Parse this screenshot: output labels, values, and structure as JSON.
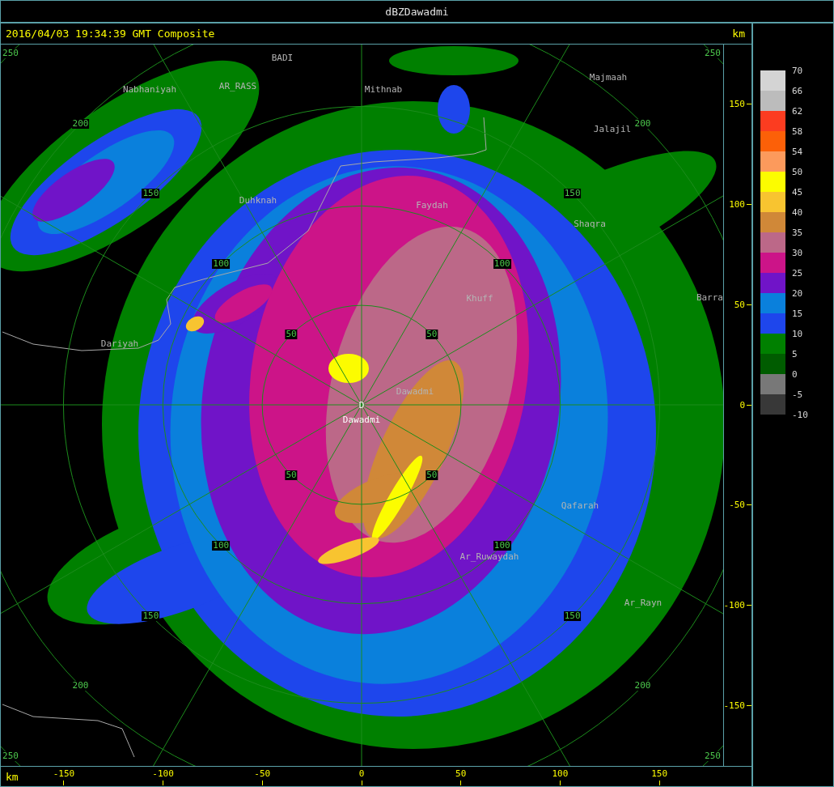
{
  "window": {
    "title": "dBZDawadmi"
  },
  "header": {
    "timestamp": "2016/04/03 19:34:39 GMT Composite",
    "unit": "km"
  },
  "map": {
    "site_marker": "D",
    "cities": [
      {
        "name": "BADI",
        "kind": "town"
      },
      {
        "name": "AR_RASS",
        "kind": "town"
      },
      {
        "name": "Mithnab",
        "kind": "town"
      },
      {
        "name": "Majmaah",
        "kind": "town"
      },
      {
        "name": "Nabhaniyah",
        "kind": "town"
      },
      {
        "name": "Jalajil",
        "kind": "town"
      },
      {
        "name": "Duhknah",
        "kind": "town"
      },
      {
        "name": "Faydah",
        "kind": "town"
      },
      {
        "name": "Shaqra",
        "kind": "town"
      },
      {
        "name": "Khuff",
        "kind": "town"
      },
      {
        "name": "Barra",
        "kind": "town"
      },
      {
        "name": "Dariyah",
        "kind": "town"
      },
      {
        "name": "Dawadmi",
        "kind": "town"
      },
      {
        "name": "Dawadmi",
        "kind": "site"
      },
      {
        "name": "Qafarah",
        "kind": "town"
      },
      {
        "name": "Ar_Ruwaydah",
        "kind": "town"
      },
      {
        "name": "Ar_Rayn",
        "kind": "town"
      }
    ],
    "range_rings": [
      {
        "labels": [
          "50",
          "50",
          "50",
          "50"
        ]
      },
      {
        "labels": [
          "100",
          "100",
          "100",
          "100"
        ]
      },
      {
        "labels": [
          "150",
          "150",
          "150",
          "150"
        ]
      },
      {
        "labels": [
          "200",
          "200",
          "200",
          "200"
        ]
      },
      {
        "labels": [
          "250",
          "250",
          "250",
          "250"
        ]
      }
    ]
  },
  "y_axis": {
    "labels": [
      "150",
      "100",
      "50",
      "0",
      "-50",
      "-100",
      "-150"
    ]
  },
  "x_axis": {
    "unit": "km",
    "labels": [
      "-150",
      "-100",
      "-50",
      "0",
      "50",
      "100",
      "150"
    ]
  },
  "legend": {
    "labels": [
      "70",
      "66",
      "62",
      "58",
      "54",
      "50",
      "45",
      "40",
      "35",
      "30",
      "25",
      "20",
      "15",
      "10",
      "5",
      "0",
      "-5",
      "-10"
    ],
    "bins": [
      {
        "color": "#d4d4d4"
      },
      {
        "color": "#bcbcbc"
      },
      {
        "color": "#fc3c20"
      },
      {
        "color": "#fc6008"
      },
      {
        "color": "#fc9a5c"
      },
      {
        "color": "#fcfc00"
      },
      {
        "color": "#f8c430"
      },
      {
        "color": "#d08838"
      },
      {
        "color": "#bc6888"
      },
      {
        "color": "#cc1488"
      },
      {
        "color": "#7014c8"
      },
      {
        "color": "#0a80dc"
      },
      {
        "color": "#1e46ec"
      },
      {
        "color": "#008000"
      },
      {
        "color": "#005c00"
      },
      {
        "color": "#787878"
      },
      {
        "color": "#383838"
      }
    ]
  }
}
